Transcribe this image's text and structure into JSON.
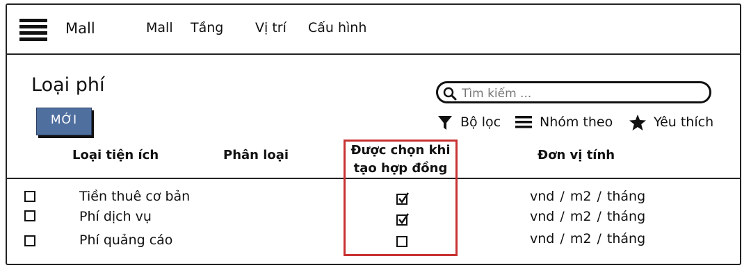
{
  "nav": {
    "brand": "Mall",
    "items": [
      "Mall",
      "Tầng",
      "Vị trí",
      "Cấu hình"
    ]
  },
  "page": {
    "title": "Loại phí",
    "new_button": "MỚI"
  },
  "search": {
    "placeholder": "Tìm kiếm ..."
  },
  "toolbar": {
    "filter": "Bộ lọc",
    "group": "Nhóm theo",
    "favorite": "Yêu thích"
  },
  "table": {
    "columns": [
      "Loại tiện ích",
      "Phân loại",
      "Được chọn khi tạo hợp đồng",
      "Đơn vị tính"
    ],
    "column_lines": {
      "selected_line1": "Được chọn khi",
      "selected_line2": "tạo hợp đồng"
    },
    "rows": [
      {
        "name": "Tiền thuê cơ bản",
        "category": "",
        "selected": true,
        "unit": "vnd / m2 / tháng"
      },
      {
        "name": "Phí dịch vụ",
        "category": "",
        "selected": true,
        "unit": "vnd / m2 / tháng"
      },
      {
        "name": "Phí quảng cáo",
        "category": "",
        "selected": false,
        "unit": "vnd / m2 / tháng"
      }
    ]
  },
  "colors": {
    "button": "#4f6f9f",
    "highlight": "#c83232"
  }
}
